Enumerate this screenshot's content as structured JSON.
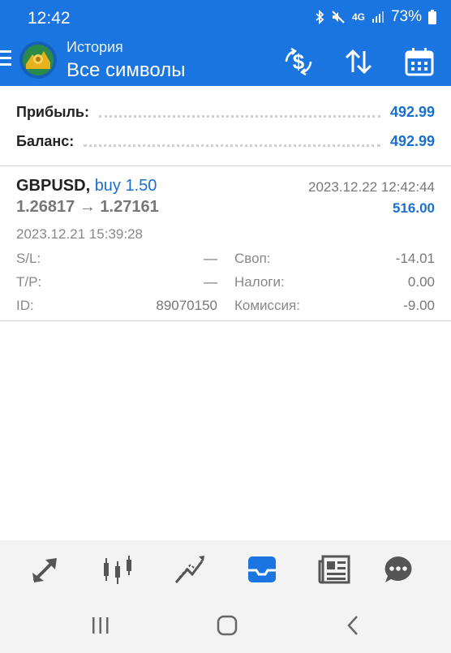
{
  "status": {
    "time": "12:42",
    "network": "4G",
    "battery": "73%",
    "icons": [
      "bluetooth-icon",
      "mute-icon",
      "network-icon",
      "signal-icon",
      "battery-icon"
    ]
  },
  "header": {
    "subtitle": "История",
    "title": "Все символы",
    "actions": [
      "currency-exchange-icon",
      "sort-icon",
      "calendar-icon"
    ],
    "menu_icon": "menu-icon",
    "logo_icon": "app-logo-icon"
  },
  "summary": {
    "profit_label": "Прибыль:",
    "profit_value": "492.99",
    "balance_label": "Баланс:",
    "balance_value": "492.99"
  },
  "trade": {
    "symbol": "GBPUSD,",
    "action": "buy 1.50",
    "prices": "1.26817 → 1.27161",
    "close_time": "2023.12.22 12:42:44",
    "profit": "516.00",
    "open_time": "2023.12.21 15:39:28",
    "sl_label": "S/L:",
    "sl_value": "—",
    "tp_label": "T/P:",
    "tp_value": "—",
    "id_label": "ID:",
    "id_value": "89070150",
    "swap_label": "Своп:",
    "swap_value": "-14.01",
    "tax_label": "Налоги:",
    "tax_value": "0.00",
    "commission_label": "Комиссия:",
    "commission_value": "-9.00"
  },
  "bottom_nav": {
    "items": [
      "quotes-icon",
      "chart-icon",
      "trade-icon",
      "history-icon",
      "news-icon",
      "chat-icon"
    ],
    "active": "history-icon"
  },
  "system_nav": [
    "recent-apps-icon",
    "home-icon",
    "back-icon"
  ],
  "colors": {
    "brand": "#1a75e0",
    "accent_text": "#1a6fd2",
    "muted": "#777777",
    "nav_inactive": "#555555"
  }
}
